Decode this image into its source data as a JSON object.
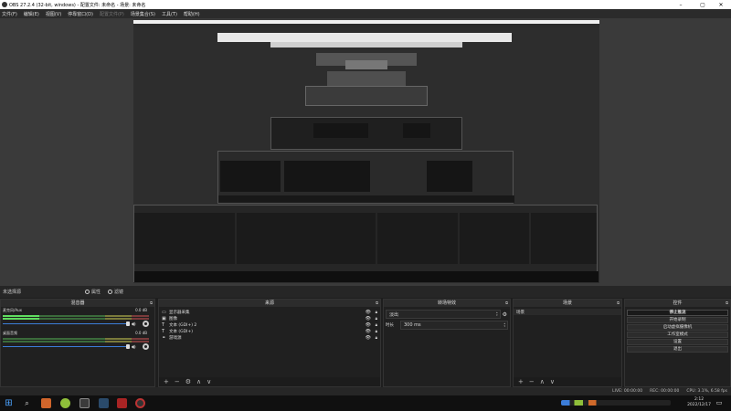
{
  "window": {
    "title": "OBS 27.2.4 (32-bit, windows) - 配置文件: 未命名 - 场景: 未命名",
    "minimize": "–",
    "maximize": "▢",
    "close": "✕"
  },
  "menu": [
    {
      "label": "文件(F)"
    },
    {
      "label": "编辑(E)"
    },
    {
      "label": "视图(V)"
    },
    {
      "label": "停靠窗口(D)"
    },
    {
      "label": "配置文件(P)"
    },
    {
      "label": "场景集合(S)"
    },
    {
      "label": "工具(T)"
    },
    {
      "label": "帮助(H)"
    }
  ],
  "mode_bar": {
    "label": "未选择源",
    "properties": "属性",
    "filters": "滤镜"
  },
  "mixer": {
    "title": "混音器",
    "channels": [
      {
        "name": "麦克风/Aux",
        "db": "0.0 dB",
        "level": 0.25
      },
      {
        "name": "桌面音频",
        "db": "0.0 dB",
        "level": 0.0
      }
    ]
  },
  "sources": {
    "title": "来源",
    "items": [
      {
        "icon": "monitor-icon",
        "glyph": "▭",
        "label": "显示器采集"
      },
      {
        "icon": "image-icon",
        "glyph": "▣",
        "label": "图像"
      },
      {
        "icon": "text-icon",
        "glyph": "T",
        "label": "文本 (GDI+) 2"
      },
      {
        "icon": "text-icon",
        "glyph": "T",
        "label": "文本 (GDI+)"
      },
      {
        "icon": "link-icon",
        "glyph": "⚭",
        "label": "游戏源"
      }
    ]
  },
  "transitions": {
    "title": "转场特效",
    "type": "淡出",
    "duration_label": "时长",
    "duration_value": "300 ms"
  },
  "scenes": {
    "title": "场景",
    "items": [
      {
        "label": "场景"
      }
    ]
  },
  "controls": {
    "title": "控件",
    "buttons": [
      {
        "label": "停止推流",
        "active": true
      },
      {
        "label": "开始录制",
        "active": false
      },
      {
        "label": "启动虚拟摄像机",
        "active": false
      },
      {
        "label": "工作室模式",
        "active": false
      },
      {
        "label": "设置",
        "active": false
      },
      {
        "label": "退出",
        "active": false
      }
    ]
  },
  "dock_footer": {
    "add": "+",
    "remove": "−",
    "settings": "⚙",
    "up": "∧",
    "down": "∨"
  },
  "status": {
    "live": "LIVE: 00:00:00",
    "rec": "REC: 00:00:00",
    "cpu": "CPU: 3.1%, 6.58 fps"
  },
  "taskbar": {
    "time": "2:12",
    "date": "2022/12/17"
  },
  "colors": {
    "accent": "#3c7dd9",
    "meter_green": "#5fdc5f",
    "stop_stream_bg": "#1a1a1a"
  }
}
